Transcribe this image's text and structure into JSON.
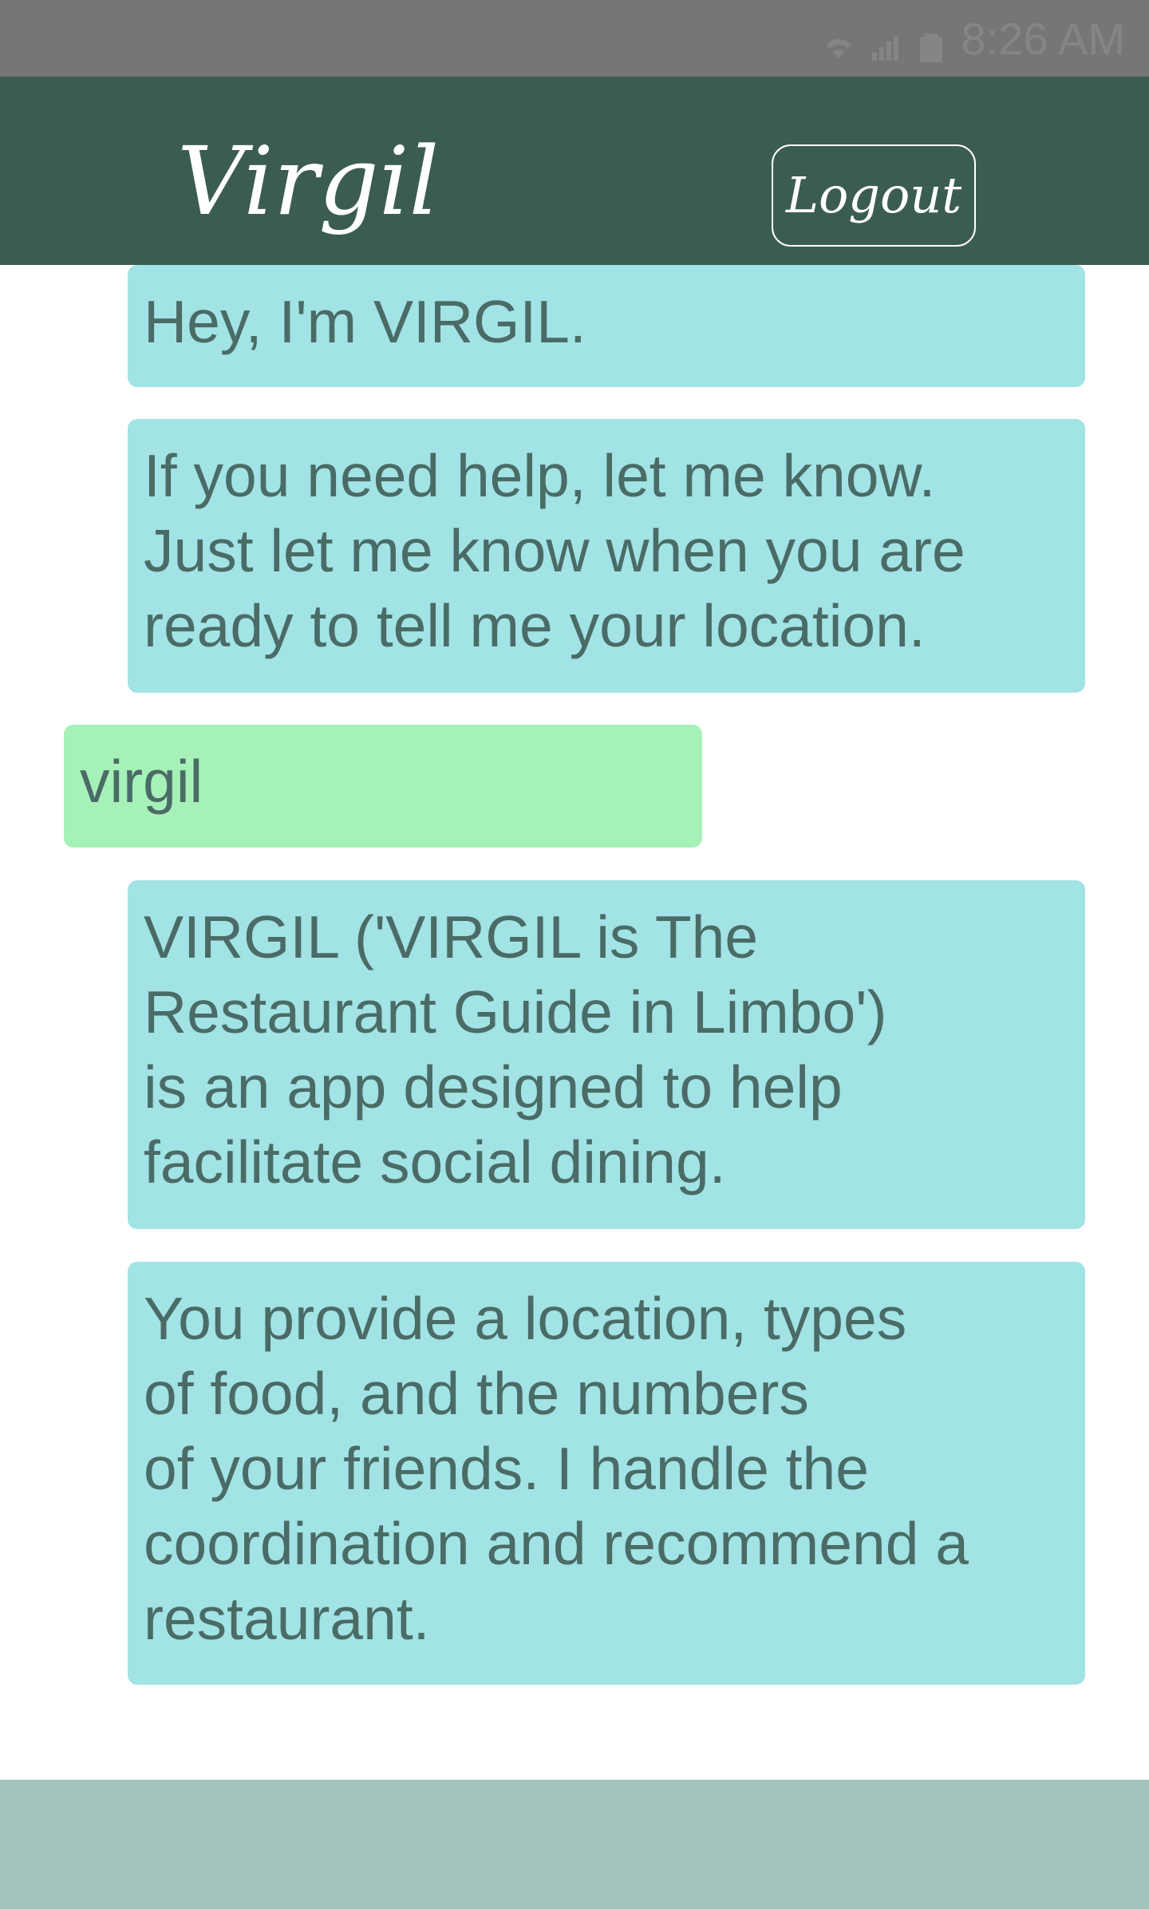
{
  "status_bar": {
    "time": "8:26 AM",
    "icons": [
      "wifi-icon",
      "signal-icon",
      "battery-icon"
    ]
  },
  "header": {
    "title": "Virgil",
    "logout_label": "Logout"
  },
  "messages": [
    {
      "sender": "bot",
      "lines": [
        "Hey, I'm VIRGIL."
      ]
    },
    {
      "sender": "bot",
      "lines": [
        "If you need help, let me know.",
        "Just let me know when you are",
        "ready to tell me your location."
      ]
    },
    {
      "sender": "user",
      "lines": [
        "virgil"
      ]
    },
    {
      "sender": "bot",
      "lines": [
        "VIRGIL ('VIRGIL is The",
        "Restaurant Guide in Limbo')",
        "is an app designed to help",
        "facilitate social dining."
      ]
    },
    {
      "sender": "bot",
      "lines": [
        "You provide a location, types",
        "of food, and the numbers",
        "of your friends. I handle the",
        "coordination and recommend a",
        "restaurant."
      ]
    }
  ],
  "colors": {
    "status_bar": "#767676",
    "header": "#3b5c51",
    "bot_bubble": "#a2e3e5",
    "user_bubble": "#a6f1b7",
    "message_text": "#4a6b66",
    "footer": "#a3c4bc"
  }
}
